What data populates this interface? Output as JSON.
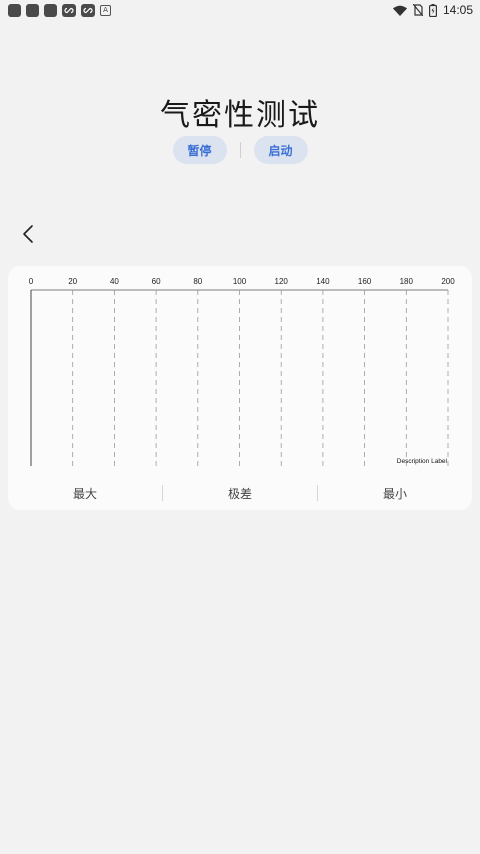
{
  "status_bar": {
    "time": "14:05",
    "left_icons": [
      "square-icon",
      "square-icon",
      "square-icon",
      "app-icon",
      "app-icon",
      "a-icon"
    ],
    "a_icon_text": "A",
    "right_icons": [
      "wifi-icon",
      "no-sim-icon",
      "battery-icon"
    ]
  },
  "page": {
    "title": "气密性测试",
    "pause_label": "暂停",
    "start_label": "启动"
  },
  "chart_data": {
    "type": "line",
    "x_ticks": [
      "0",
      "20",
      "40",
      "60",
      "80",
      "100",
      "120",
      "140",
      "160",
      "180",
      "200"
    ],
    "xlim": [
      0,
      200
    ],
    "series": [],
    "description_label": "Description Label",
    "grid": "vertical dashed"
  },
  "stats": {
    "max_label": "最大",
    "range_label": "极差",
    "min_label": "最小"
  },
  "colors": {
    "background": "#f2f2f2",
    "card": "#fbfbfb",
    "pill_bg": "#dbe3f0",
    "pill_text": "#3b6fd4"
  }
}
